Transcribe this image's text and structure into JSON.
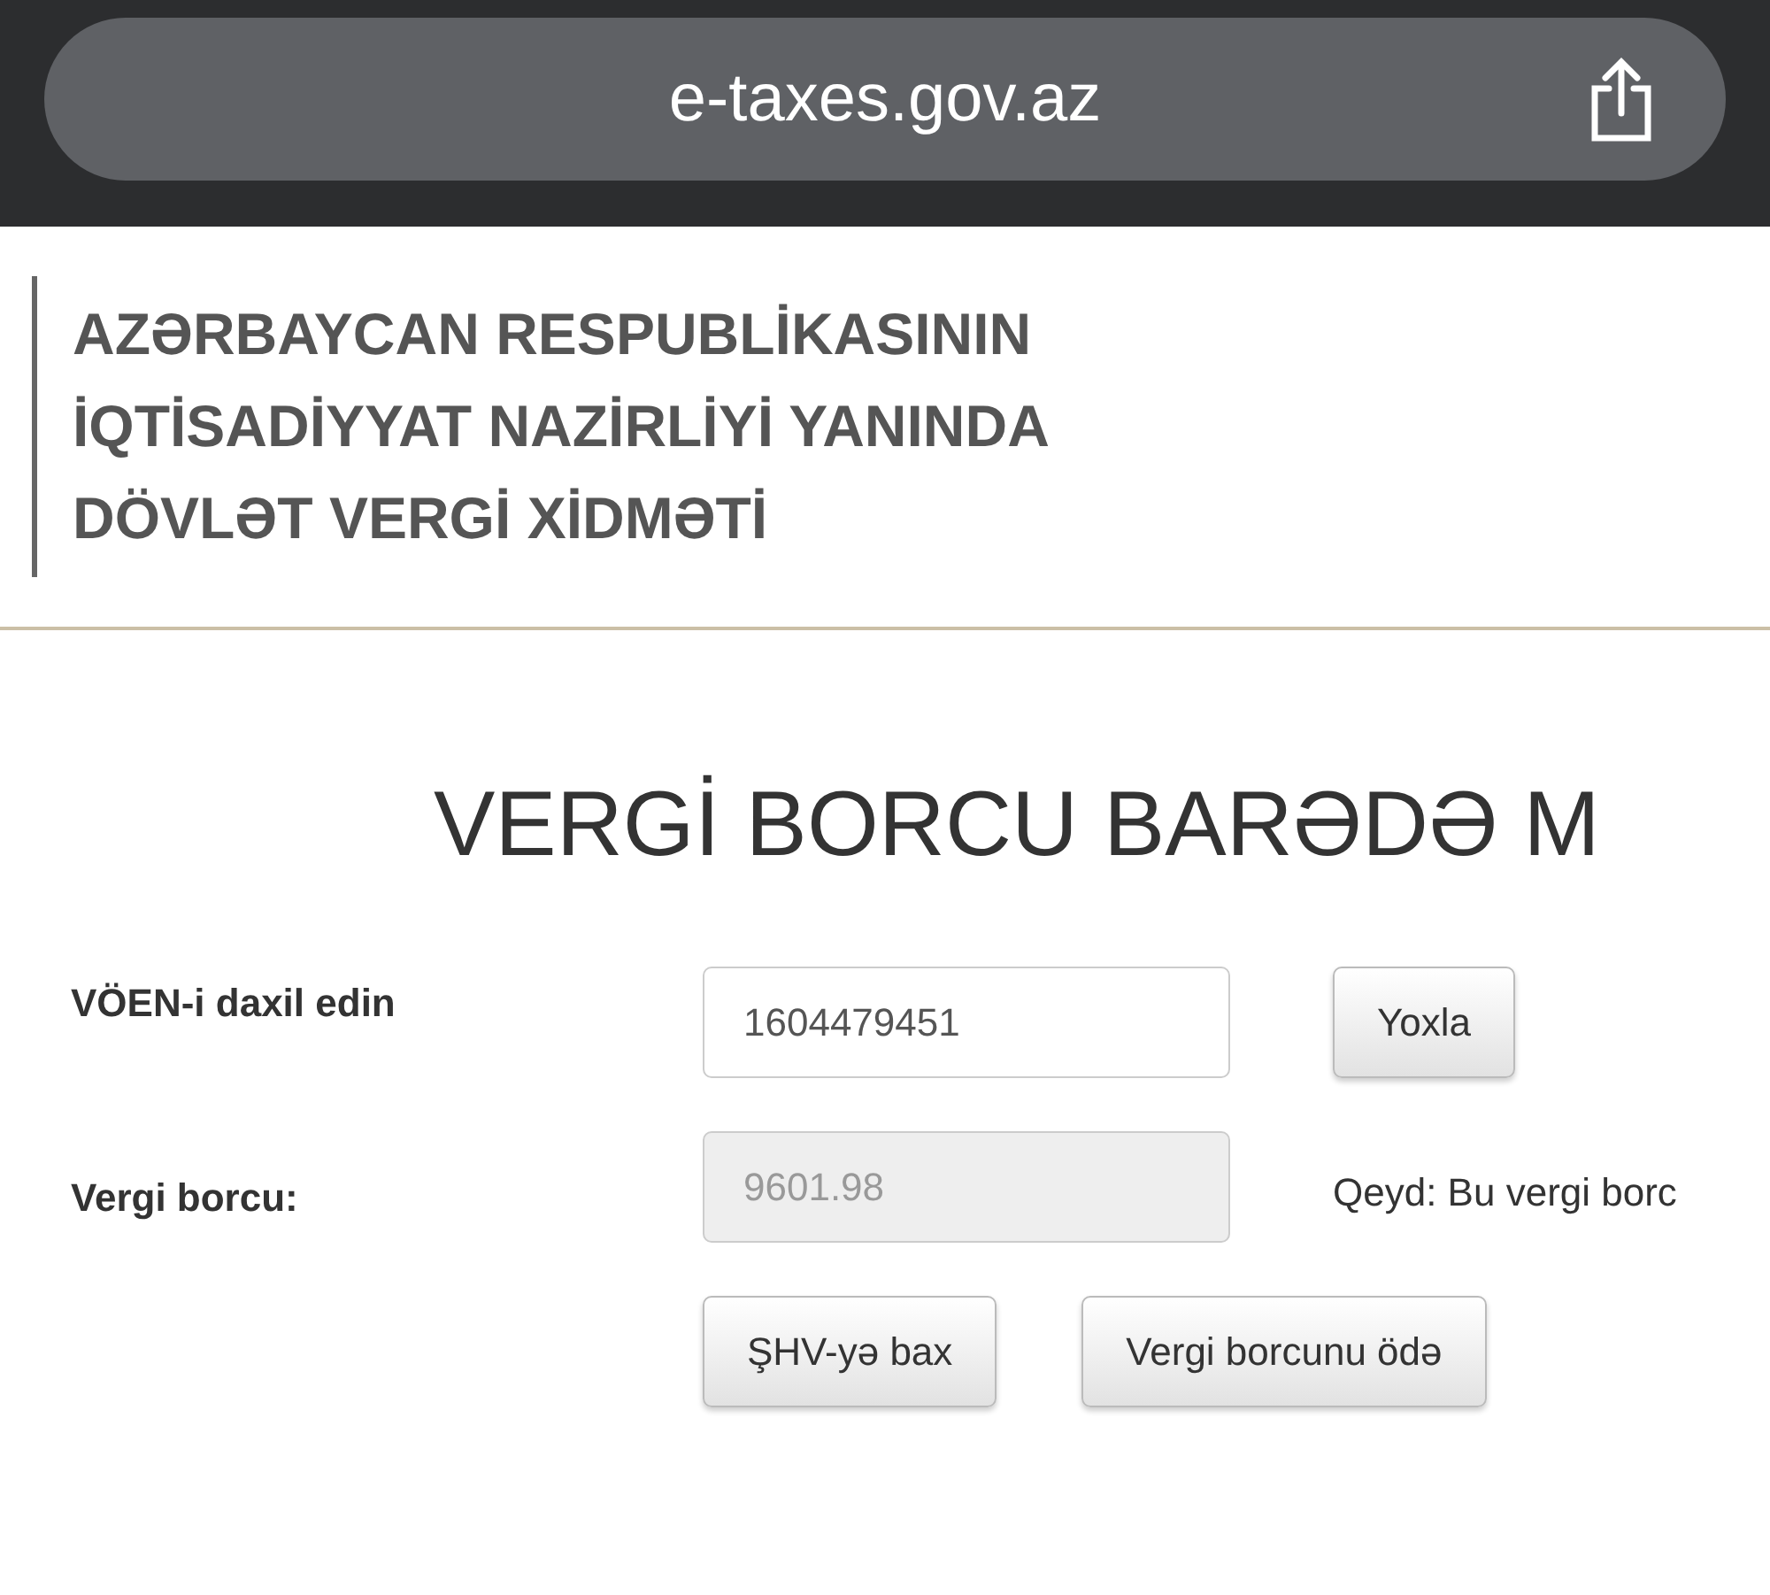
{
  "browser": {
    "url": "e-taxes.gov.az"
  },
  "logo": {
    "lines": [
      "AZƏRBAYCAN RESPUBLİKASININ",
      "İQTİSADİYYAT NAZİRLİYİ YANINDA",
      "DÖVLƏT VERGİ XİDMƏTİ"
    ]
  },
  "page": {
    "title": "VERGİ BORCU BARƏDƏ M"
  },
  "form": {
    "tin_label": "VÖEN-i daxil edin",
    "tin_value": "1604479451",
    "check_button": "Yoxla",
    "debt_label": "Vergi borcu:",
    "debt_value": "9601.98",
    "debt_disabled": true,
    "note": "Qeyd: Bu vergi borc"
  },
  "buttons": [
    "ŞHV-yə bax",
    "Vergi borcunu ödə"
  ]
}
